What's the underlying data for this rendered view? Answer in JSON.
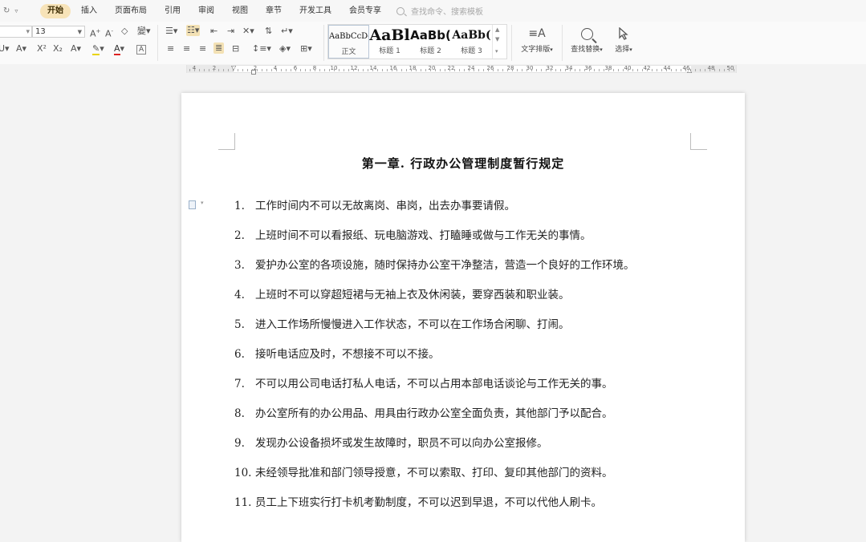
{
  "menubar": {
    "tabs": [
      {
        "label": "开始",
        "active": true
      },
      {
        "label": "插入"
      },
      {
        "label": "页面布局"
      },
      {
        "label": "引用"
      },
      {
        "label": "审阅"
      },
      {
        "label": "视图"
      },
      {
        "label": "章节"
      },
      {
        "label": "开发工具"
      },
      {
        "label": "会员专享"
      }
    ],
    "search_placeholder": "查找命令、搜索模板"
  },
  "ribbon": {
    "font_size": "13",
    "styles": [
      {
        "preview": "AaBbCcDd",
        "label": "正文"
      },
      {
        "preview": "AaBl",
        "label": "标题 1"
      },
      {
        "preview": "AaBb(",
        "label": "标题 2"
      },
      {
        "preview": "AaBb(",
        "label": "标题 3"
      }
    ],
    "text_layout_label": "文字排版",
    "find_replace_label": "查找替换",
    "select_label": "选择"
  },
  "ruler": {
    "labels": [
      "4",
      "2",
      "2",
      "4",
      "6",
      "8",
      "10",
      "12",
      "14",
      "16",
      "18",
      "20",
      "22",
      "24",
      "26",
      "28",
      "30",
      "32",
      "34",
      "36",
      "38",
      "40",
      "42",
      "44",
      "46",
      "48",
      "50"
    ]
  },
  "document": {
    "title": "第一章. 行政办公管理制度暂行规定",
    "items": [
      {
        "num": "1.",
        "text": "工作时间内不可以无故离岗、串岗，出去办事要请假。"
      },
      {
        "num": "2.",
        "text": "上班时间不可以看报纸、玩电脑游戏、打瞌睡或做与工作无关的事情。"
      },
      {
        "num": "3.",
        "text": "爱护办公室的各项设施，随时保持办公室干净整洁，营造一个良好的工作环境。"
      },
      {
        "num": "4.",
        "text": "上班时不可以穿超短裙与无袖上衣及休闲装，要穿西装和职业装。"
      },
      {
        "num": "5.",
        "text": "进入工作场所慢慢进入工作状态，不可以在工作场合闲聊、打闹。"
      },
      {
        "num": "6.",
        "text": "接听电话应及时，不想接不可以不接。"
      },
      {
        "num": "7.",
        "text": "不可以用公司电话打私人电话，不可以占用本部电话谈论与工作无关的事。"
      },
      {
        "num": "8.",
        "text": "办公室所有的办公用品、用具由行政办公室全面负责，其他部门予以配合。"
      },
      {
        "num": "9.",
        "text": "发现办公设备损坏或发生故障时，职员不可以向办公室报修。"
      },
      {
        "num": "10.",
        "text": "未经领导批准和部门领导授意，不可以索取、打印、复印其他部门的资料。"
      },
      {
        "num": "11.",
        "text": "员工上下班实行打卡机考勤制度，不可以迟到早退，不可以代他人刷卡。"
      }
    ]
  }
}
